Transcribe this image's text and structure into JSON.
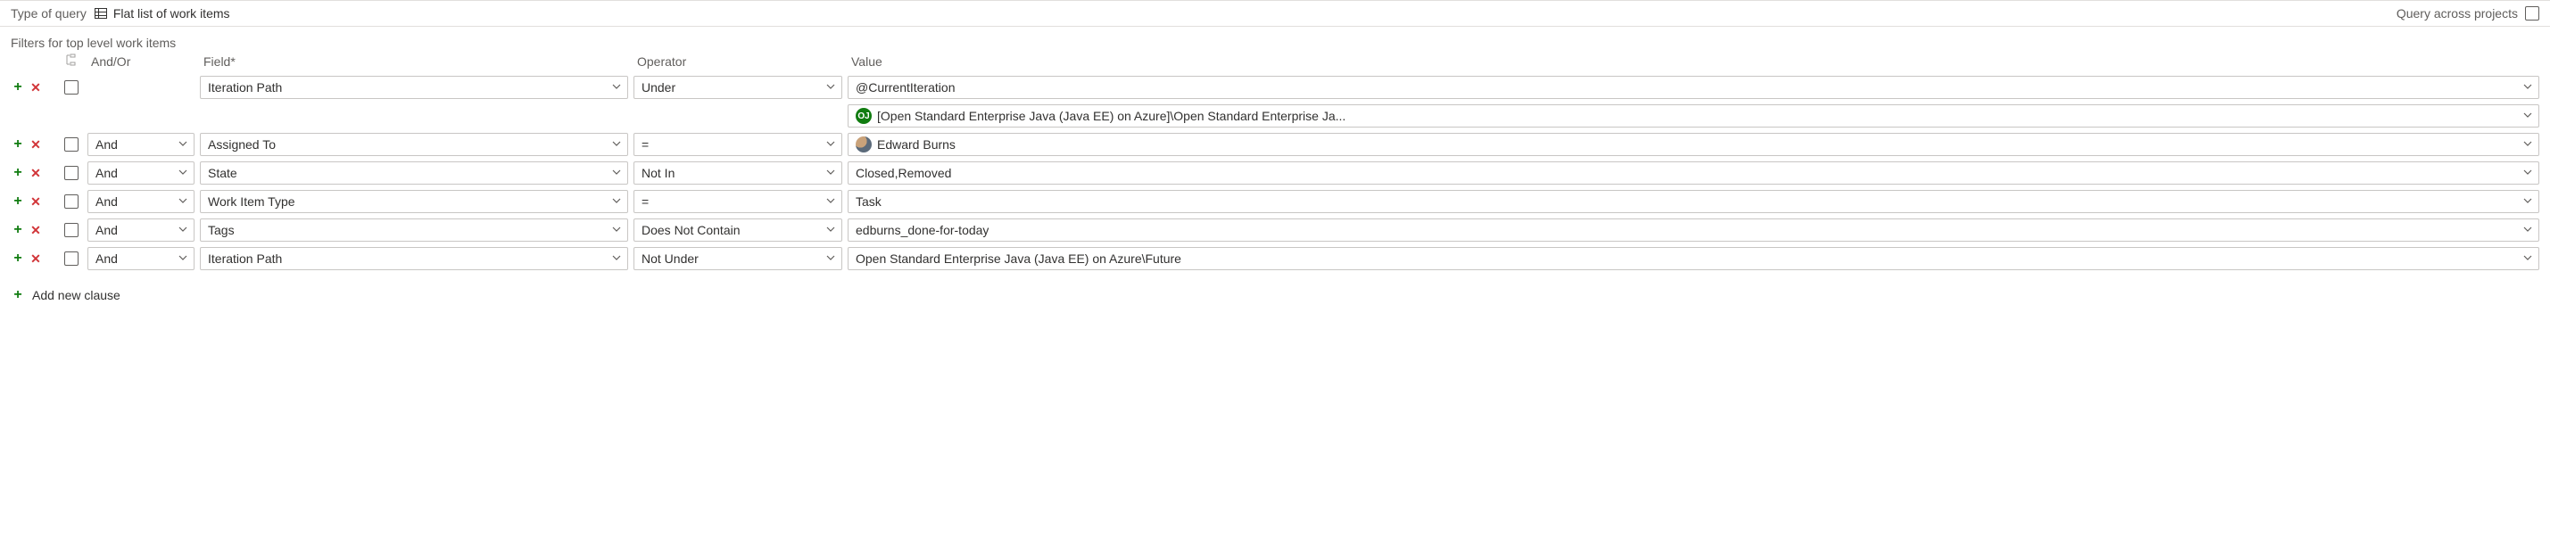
{
  "top": {
    "query_type_label": "Type of query",
    "query_type_value": "Flat list of work items",
    "cross_projects_label": "Query across projects"
  },
  "section_title": "Filters for top level work items",
  "headers": {
    "andor": "And/Or",
    "field": "Field*",
    "operator": "Operator",
    "value": "Value"
  },
  "rows": [
    {
      "andor": "",
      "field": "Iteration Path",
      "operator": "Under",
      "value": "@CurrentIteration",
      "value_icon": "none",
      "show_andor": false,
      "sub": {
        "project_badge": "OJ",
        "text": "[Open Standard Enterprise Java (Java EE) on Azure]\\Open Standard Enterprise Ja..."
      }
    },
    {
      "andor": "And",
      "field": "Assigned To",
      "operator": "=",
      "value": "Edward Burns",
      "value_icon": "avatar",
      "show_andor": true
    },
    {
      "andor": "And",
      "field": "State",
      "operator": "Not In",
      "value": "Closed,Removed",
      "value_icon": "none",
      "show_andor": true
    },
    {
      "andor": "And",
      "field": "Work Item Type",
      "operator": "=",
      "value": "Task",
      "value_icon": "none",
      "show_andor": true
    },
    {
      "andor": "And",
      "field": "Tags",
      "operator": "Does Not Contain",
      "value": "edburns_done-for-today",
      "value_icon": "none",
      "show_andor": true
    },
    {
      "andor": "And",
      "field": "Iteration Path",
      "operator": "Not Under",
      "value": "Open Standard Enterprise Java (Java EE) on Azure\\Future",
      "value_icon": "none",
      "show_andor": true
    }
  ],
  "add_clause_label": "Add new clause"
}
